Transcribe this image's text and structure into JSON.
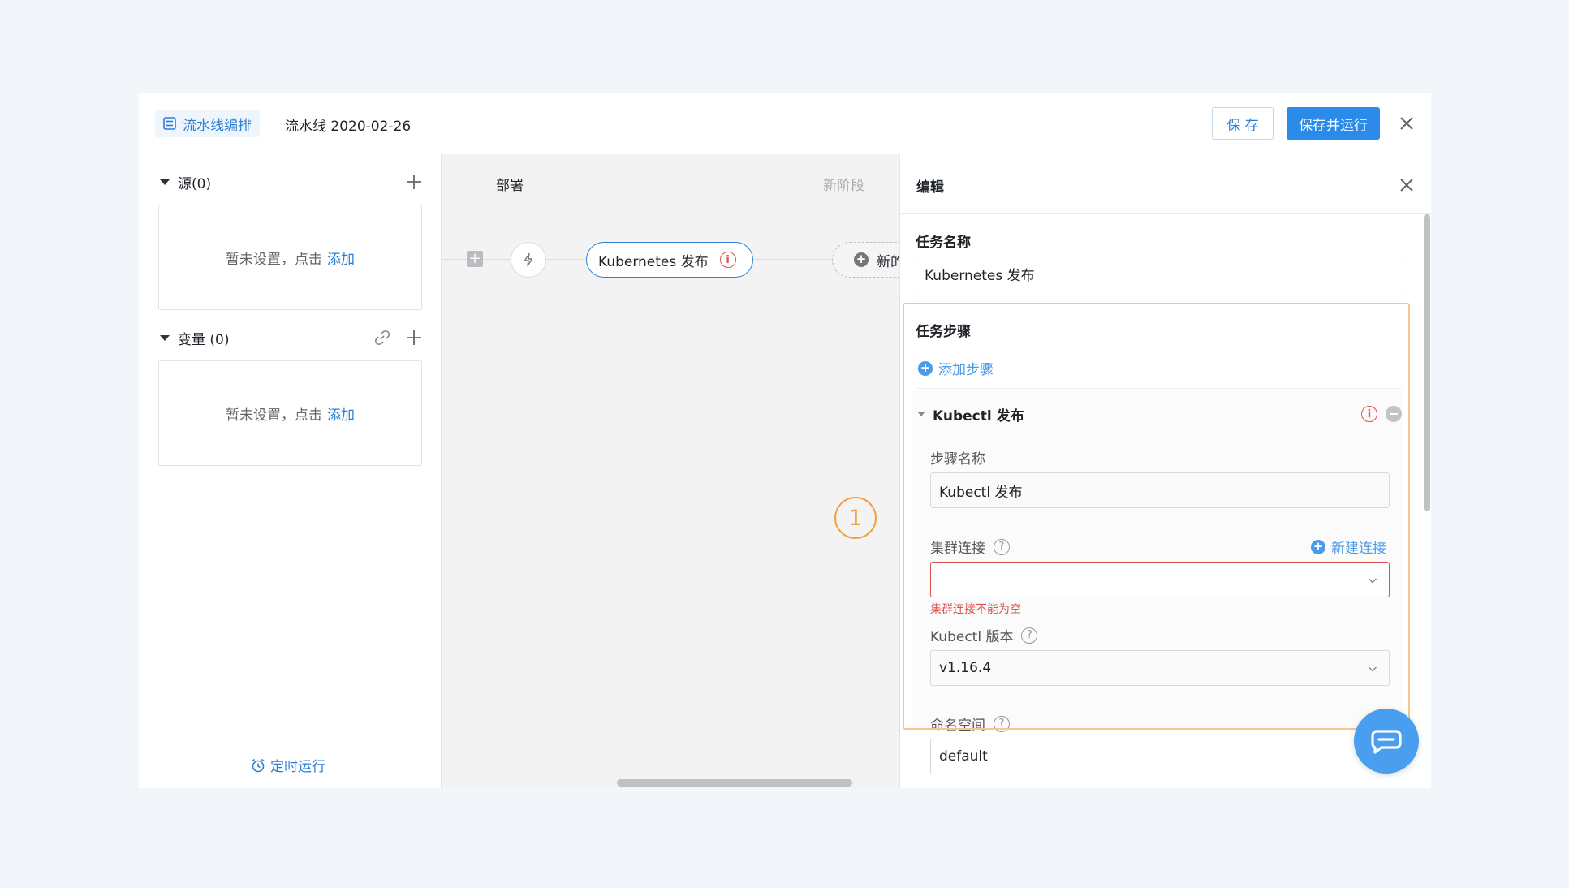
{
  "header": {
    "brand_label": "流水线编排",
    "pipeline_name": "流水线 2020-02-26",
    "save_label": "保 存",
    "save_run_label": "保存并运行"
  },
  "left": {
    "source_title": "源(0)",
    "variables_title": "变量 (0)",
    "empty_text": "暂未设置，点击",
    "add_link": "添加",
    "timer_label": "定时运行"
  },
  "canvas": {
    "stage_deploy": "部署",
    "stage_new": "新阶段",
    "task_name": "Kubernetes 发布",
    "new_task": "新的"
  },
  "badge": "1",
  "edit": {
    "title": "编辑",
    "task_name_label": "任务名称",
    "task_name_value": "Kubernetes 发布",
    "steps_label": "任务步骤",
    "add_step": "添加步骤",
    "step_title": "Kubectl 发布",
    "step_name_label": "步骤名称",
    "step_name_value": "Kubectl 发布",
    "cluster_label": "集群连接",
    "new_connection": "新建连接",
    "cluster_error": "集群连接不能为空",
    "kubectl_version_label": "Kubectl 版本",
    "kubectl_version_value": "v1.16.4",
    "namespace_label": "命名空间",
    "namespace_value": "default"
  },
  "colors": {
    "primary": "#2a8be8",
    "link": "#2a7fd4",
    "error": "#d9534f",
    "highlight": "#f5c78a",
    "badge": "#f0a03c"
  }
}
